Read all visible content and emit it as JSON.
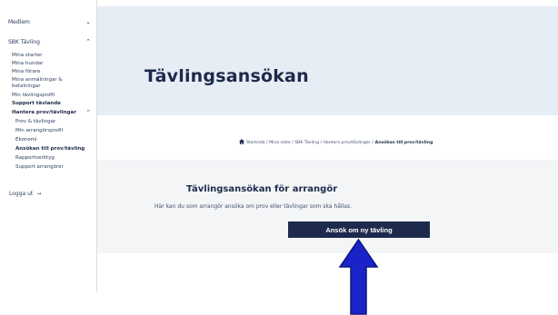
{
  "sidebar": {
    "sections": [
      {
        "label": "Medlem",
        "chevron": "⌄"
      },
      {
        "label": "SBK Tävling",
        "chevron": "⌃"
      }
    ],
    "items": [
      "Mina starter",
      "Mina hundar",
      "Mina förare",
      "Mina anmälningar &",
      "betalningar",
      "Min tävlingsprofil",
      "Support tävlande",
      "Hantera prov/tävlingar",
      "Prov & tävlingar",
      "Min arrangörsprofil",
      "Ekonomi",
      "Ansökan till prov/tävling",
      "Rapportverktyg",
      "Support arrangörer"
    ],
    "hantera_chevron": "⌃",
    "logout_label": "Logga ut",
    "logout_icon": "→"
  },
  "hero": {
    "title": "Tävlingsansökan"
  },
  "breadcrumb": {
    "home_icon": "house-icon",
    "path": "Startsida / Mina sidor / SBK Tävling / Hantera prov/tävlingar /",
    "current": "Ansökan till prov/tävling"
  },
  "main": {
    "heading": "Tävlingsansökan för arrangör",
    "description": "Här kan du som arrangör ansöka om prov eller tävlingar som ska hållas.",
    "button_label": "Ansök om ny tävling"
  },
  "colors": {
    "navy": "#1d2a4d",
    "hero_bg": "#e6edf5",
    "arrow": "#1a23c8"
  }
}
